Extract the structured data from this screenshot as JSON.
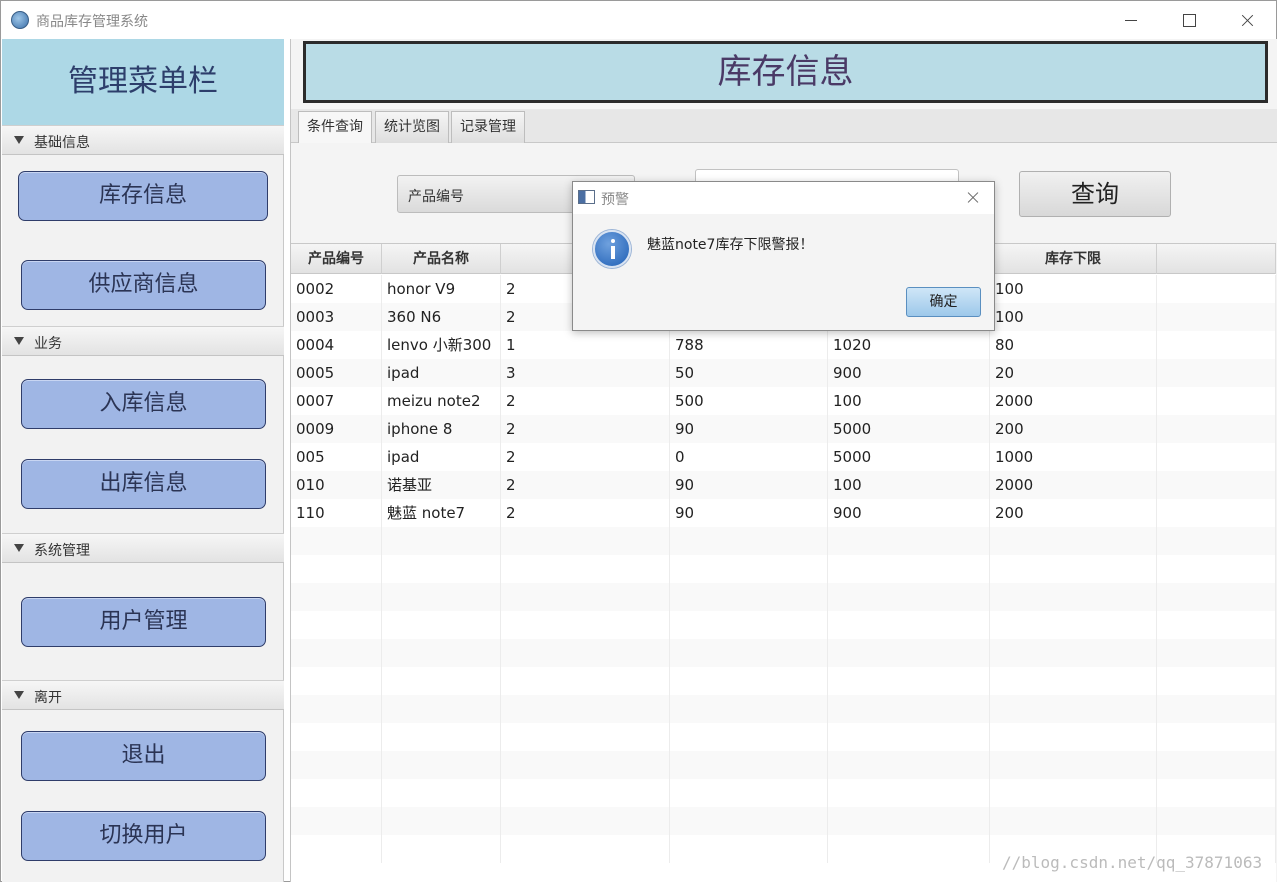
{
  "window": {
    "title": "商品库存管理系统"
  },
  "sidebar": {
    "header": "管理菜单栏",
    "sections": [
      {
        "label": "基础信息",
        "buttons": [
          "库存信息",
          "供应商信息"
        ]
      },
      {
        "label": "业务",
        "buttons": [
          "入库信息",
          "出库信息"
        ]
      },
      {
        "label": "系统管理",
        "buttons": [
          "用户管理"
        ]
      },
      {
        "label": "离开",
        "buttons": [
          "退出",
          "切换用户"
        ]
      }
    ]
  },
  "main": {
    "title": "库存信息",
    "tabs": [
      "条件查询",
      "统计览图",
      "记录管理"
    ],
    "active_tab": "条件查询",
    "query": {
      "field_selected": "产品编号",
      "input_value": "",
      "button_label": "查询"
    },
    "table": {
      "columns": [
        "产品编号",
        "产品名称",
        "",
        "",
        "",
        "",
        "库存下限"
      ],
      "rows": [
        [
          "0002",
          "honor V9",
          "2",
          "",
          "",
          "",
          "100"
        ],
        [
          "0003",
          "360 N6",
          "2",
          "",
          "",
          "",
          "100"
        ],
        [
          "0004",
          "lenvo 小新300",
          "1",
          "788",
          "1020",
          "80",
          ""
        ],
        [
          "0005",
          "ipad",
          "3",
          "50",
          "900",
          "20",
          ""
        ],
        [
          "0007",
          "meizu note2",
          "2",
          "500",
          "100",
          "2000",
          ""
        ],
        [
          "0009",
          "iphone 8",
          "2",
          "90",
          "5000",
          "200",
          ""
        ],
        [
          "005",
          "ipad",
          "2",
          "0",
          "5000",
          "1000",
          ""
        ],
        [
          "010",
          "诺基亚",
          "2",
          "90",
          "100",
          "2000",
          ""
        ],
        [
          "110",
          "魅蓝 note7",
          "2",
          "90",
          "900",
          "200",
          ""
        ]
      ]
    }
  },
  "dialog": {
    "title": "预警",
    "message": "魅蓝note7库存下限警报！",
    "ok_label": "确定"
  },
  "watermark": "//blog.csdn.net/qq_37871063"
}
